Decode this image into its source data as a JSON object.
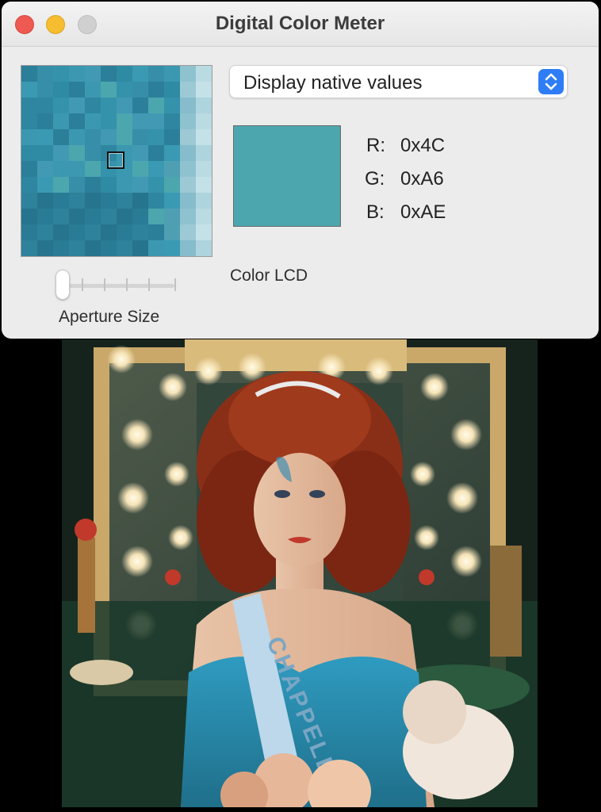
{
  "window": {
    "title": "Digital Color Meter",
    "traffic_lights": {
      "close_color": "#ee5a52",
      "minimize_color": "#f5bd2f",
      "zoom_color": "#d0d0d0"
    }
  },
  "display_menu": {
    "selected": "Display native values",
    "accent_color": "#2f7df6"
  },
  "sample": {
    "swatch_color": "#4ca6ae",
    "channels": [
      {
        "label": "R:",
        "value": "0x4C"
      },
      {
        "label": "G:",
        "value": "0xA6"
      },
      {
        "label": "B:",
        "value": "0xAE"
      }
    ]
  },
  "display_name": "Color LCD",
  "aperture": {
    "label": "Aperture Size",
    "level": 0.0
  },
  "photo_sash_text": "CHAPPELL"
}
